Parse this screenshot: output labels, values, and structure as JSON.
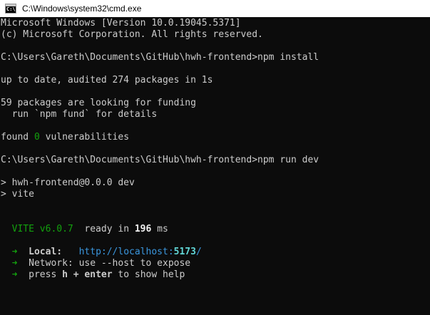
{
  "window": {
    "title": "C:\\Windows\\system32\\cmd.exe",
    "icon": "cmd-icon"
  },
  "console": {
    "lines": [
      "Microsoft Windows [Version 10.0.19045.5371]",
      "(c) Microsoft Corporation. All rights reserved.",
      "C:\\Users\\Gareth\\Documents\\GitHub\\hwh-frontend>npm install",
      "up to date, audited 274 packages in 1s",
      "59 packages are looking for funding",
      "  run `npm fund` for details",
      "found ",
      "0",
      " vulnerabilities",
      "C:\\Users\\Gareth\\Documents\\GitHub\\hwh-frontend>npm run dev",
      "> hwh-frontend@0.0.0 dev",
      "> vite"
    ],
    "vite": {
      "name": "VITE v6.0.7",
      "ready": "ready in ",
      "ms_value": "196",
      "ms_unit": " ms",
      "arrow": "➜",
      "local_label": "Local:",
      "local_url_base": "http://localhost:",
      "local_url_port": "5173",
      "local_url_slash": "/",
      "network_label": "Network:",
      "network_text": "use --host to expose",
      "help_prefix": "press ",
      "help_key": "h + enter",
      "help_suffix": " to show help"
    }
  },
  "colors": {
    "background": "#0c0c0c",
    "text": "#cccccc",
    "green": "#13a10e",
    "cyan": "#3a96dd"
  }
}
